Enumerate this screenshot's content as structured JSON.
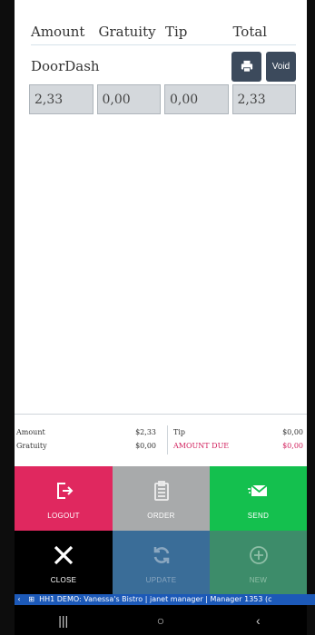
{
  "payment": {
    "headers": {
      "amount": "Amount",
      "gratuity": "Gratuity",
      "tip": "Tip",
      "total": "Total"
    },
    "tender": {
      "name": "DoorDash",
      "print_icon": "printer-icon",
      "void_label": "Void"
    },
    "values": {
      "amount": "2,33",
      "gratuity": "0,00",
      "tip": "0,00",
      "total": "2,33"
    }
  },
  "summary": {
    "amount_label": "Amount",
    "amount_value": "$2,33",
    "gratuity_label": "Gratuity",
    "gratuity_value": "$0,00",
    "tip_label": "Tip",
    "tip_value": "$0,00",
    "due_label": "AMOUNT DUE",
    "due_value": "$0,00"
  },
  "buttons": {
    "logout": "LOGOUT",
    "order": "ORDER",
    "send": "SEND",
    "close": "CLOSE",
    "update": "UPDATE",
    "new": "NEW"
  },
  "status_bar": {
    "text": "HH1  DEMO: Vanessa's Bistro | janet manager | Manager 1353 (c"
  },
  "colors": {
    "logout": "#e0285f",
    "order": "#a8aaab",
    "send": "#14c04e",
    "close": "#000000",
    "update": "#3a6d98",
    "new": "#3d8c6a",
    "amount_due": "#d11f5c",
    "status_bar": "#1c59b8"
  }
}
